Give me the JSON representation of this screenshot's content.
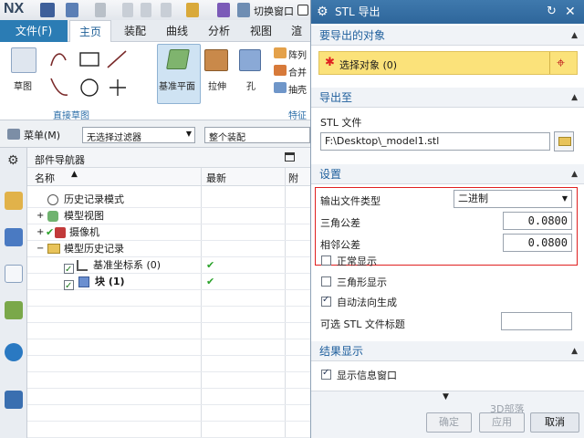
{
  "app": {
    "logo": "NX",
    "switch_window": "切换窗口"
  },
  "tabs": {
    "file": "文件(F)",
    "items": [
      "主页",
      "装配",
      "曲线",
      "分析",
      "视图",
      "渲"
    ]
  },
  "ribbon": {
    "sketch_label": "草图",
    "direct_sketch_group": "直接草图",
    "datum_plane_label": "基准平面",
    "extrude_label": "拉伸",
    "hole_label": "孔",
    "array_label": "阵列",
    "unite_label": "合并",
    "shell_label": "抽壳",
    "feature_group": "特征"
  },
  "filterbar": {
    "menu": "菜单(M)",
    "filter": "无选择过滤器",
    "assembly": "整个装配"
  },
  "navigator": {
    "title": "部件导航器",
    "col_name": "名称",
    "col_latest": "最新",
    "col_extra": "附",
    "rows": [
      {
        "label": "历史记录模式",
        "check": ""
      },
      {
        "label": "模型视图",
        "check": ""
      },
      {
        "label": "摄像机",
        "check": ""
      },
      {
        "label": "模型历史记录",
        "check": ""
      },
      {
        "label": "基准坐标系 (0)",
        "check": "✔"
      },
      {
        "label": "块 (1)",
        "check": "✔"
      }
    ]
  },
  "dialog": {
    "title": "STL 导出",
    "sec_objects": "要导出的对象",
    "select_object": "选择对象 (0)",
    "sec_export_to": "导出至",
    "stl_file_label": "STL 文件",
    "stl_file_value": "F:\\Desktop\\_model1.stl",
    "sec_settings": "设置",
    "output_type_label": "输出文件类型",
    "output_type_value": "二进制",
    "triangle_tol_label": "三角公差",
    "triangle_tol_value": "0.0800",
    "adjacent_tol_label": "相邻公差",
    "adjacent_tol_value": "0.0800",
    "normal_display": "正常显示",
    "triangle_display": "三角形显示",
    "auto_normal": "自动法向生成",
    "optional_header": "可选 STL 文件标题",
    "optional_header_value": "",
    "sec_result": "结果显示",
    "show_info": "显示信息窗口",
    "ok": "确定",
    "apply": "应用",
    "cancel": "取消"
  },
  "watermark": "3D部落",
  "colors": {
    "accent": "#2b7cb4",
    "highlight_yellow": "#fbe27a",
    "red_box": "#e02020",
    "title_bar": "#2e669b"
  }
}
